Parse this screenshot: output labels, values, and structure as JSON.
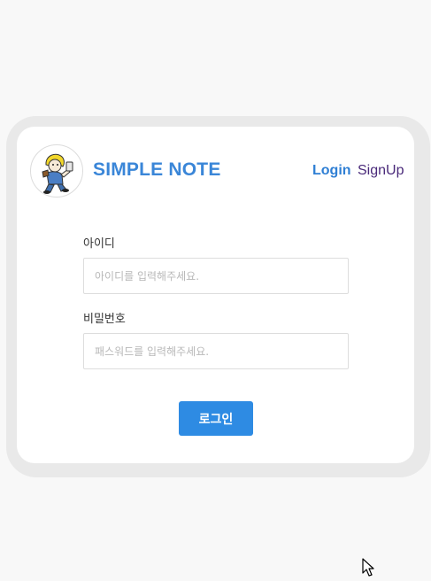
{
  "header": {
    "brand": "SIMPLE NOTE",
    "logo_icon": "mascot-logo-icon",
    "nav_login": "Login",
    "nav_signup": "SignUp"
  },
  "form": {
    "id_label": "아이디",
    "id_placeholder": "아이디를 입력해주세요.",
    "id_value": "",
    "password_label": "비밀번호",
    "password_placeholder": "패스워드를 입력해주세요.",
    "password_value": "",
    "submit_label": "로그인"
  },
  "colors": {
    "brand": "#3a86d8",
    "login_link": "#2f7fd4",
    "signup_link": "#4a2a7a",
    "button": "#2e8be3",
    "card_border": "#e9e9e9",
    "background": "#f8f8f8"
  },
  "pointer_icon": "mouse-cursor-icon"
}
